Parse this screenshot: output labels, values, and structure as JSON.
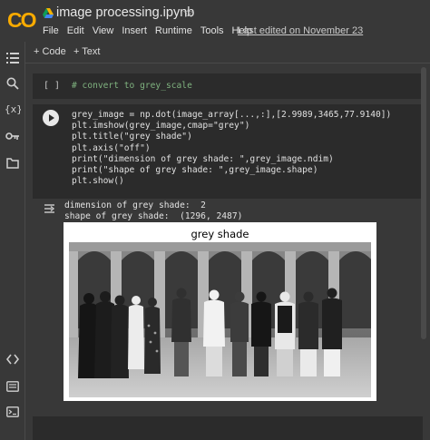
{
  "header": {
    "logo_text": "CO",
    "notebook_title": "image processing.ipynb",
    "star_glyph": "☆",
    "menu": [
      "File",
      "Edit",
      "View",
      "Insert",
      "Runtime",
      "Tools",
      "Help"
    ],
    "last_edited": "Last edited on November 23"
  },
  "toolbar": {
    "code_label": "+ Code",
    "text_label": "+ Text"
  },
  "rail_icons": [
    "table-of-contents-icon",
    "search-icon",
    "variables-icon",
    "secrets-key-icon",
    "files-folder-icon",
    "code-snippets-icon",
    "command-palette-icon",
    "terminal-icon"
  ],
  "cell1": {
    "exec_count": "[ ]",
    "code": "# convert to grey_scale"
  },
  "cell2": {
    "code_lines": [
      "grey_image = np.dot(image_array[...,:],[2.9989,3465,77.9140])",
      "plt.imshow(grey_image,cmap=\"grey\")",
      "plt.title(\"grey shade\")",
      "plt.axis(\"off\")",
      "print(\"dimension of grey shade: \",grey_image.ndim)",
      "print(\"shape of grey shade: \",grey_image.shape)",
      "plt.show()"
    ],
    "output_lines": [
      "dimension of grey shade:  2",
      "shape of grey shade:  (1296, 2487)"
    ],
    "plot_title": "grey shade"
  },
  "colors": {
    "background": "#383838",
    "cell_background": "#2b2b2b",
    "logo_orange": "#f9ab00",
    "logo_amber": "#e8710a",
    "comment_green": "#7fb27f"
  }
}
